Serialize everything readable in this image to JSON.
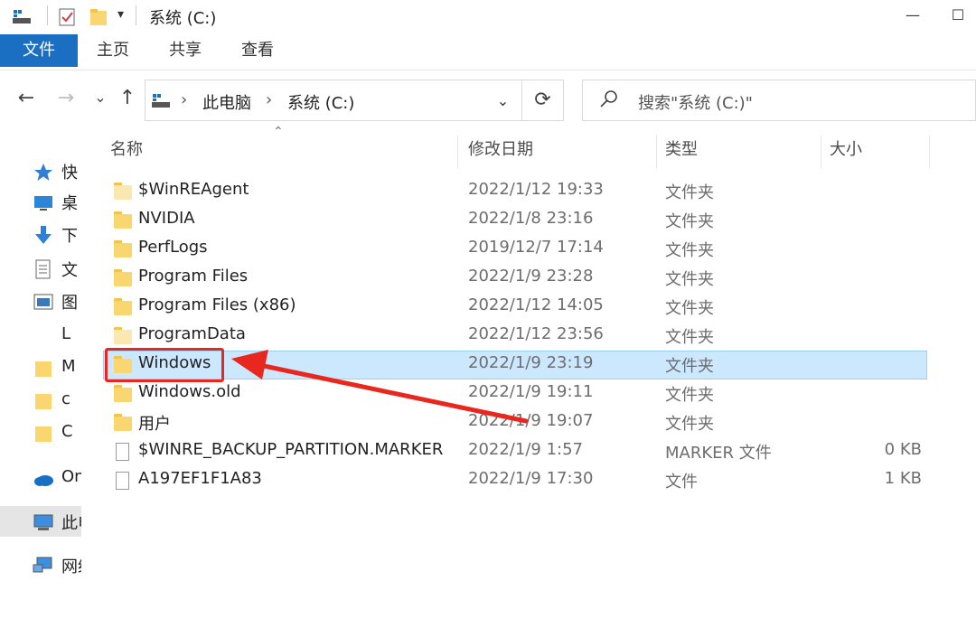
{
  "window": {
    "title": "系统 (C:)",
    "controls": {
      "minimize": "—",
      "maximize": "☐"
    }
  },
  "ribbon": {
    "tabs": [
      {
        "label": "文件"
      },
      {
        "label": "主页"
      },
      {
        "label": "共享"
      },
      {
        "label": "查看"
      }
    ]
  },
  "navigation": {
    "back": "←",
    "forward": "→",
    "recent": "⌄",
    "up": "↑",
    "breadcrumb": [
      {
        "label": "此电脑"
      },
      {
        "label": "系统 (C:)"
      }
    ],
    "refresh": "⟳",
    "search_placeholder": "搜索\"系统 (C:)\""
  },
  "nav_pane": {
    "items": [
      {
        "label": "快",
        "icon": "star-icon"
      },
      {
        "label": "桌",
        "icon": "desktop-icon"
      },
      {
        "label": "下",
        "icon": "download-icon"
      },
      {
        "label": "文",
        "icon": "documents-icon"
      },
      {
        "label": "图",
        "icon": "pictures-icon"
      },
      {
        "label": "L",
        "icon": "folder-icon"
      },
      {
        "label": "M",
        "icon": "folder-icon"
      },
      {
        "label": "c",
        "icon": "folder-icon"
      },
      {
        "label": "C",
        "icon": "folder-icon"
      },
      {
        "label": "On",
        "icon": "cloud-icon"
      },
      {
        "label": "此电",
        "icon": "this-pc-icon"
      },
      {
        "label": "网络",
        "icon": "network-icon"
      }
    ]
  },
  "columns": {
    "name": "名称",
    "date": "修改日期",
    "type": "类型",
    "size": "大小"
  },
  "files": [
    {
      "name": "$WinREAgent",
      "date": "2022/1/12 19:33",
      "type": "文件夹",
      "size": "",
      "kind": "folder-faded"
    },
    {
      "name": "NVIDIA",
      "date": "2022/1/8 23:16",
      "type": "文件夹",
      "size": "",
      "kind": "folder"
    },
    {
      "name": "PerfLogs",
      "date": "2019/12/7 17:14",
      "type": "文件夹",
      "size": "",
      "kind": "folder"
    },
    {
      "name": "Program Files",
      "date": "2022/1/9 23:28",
      "type": "文件夹",
      "size": "",
      "kind": "folder"
    },
    {
      "name": "Program Files (x86)",
      "date": "2022/1/12 14:05",
      "type": "文件夹",
      "size": "",
      "kind": "folder"
    },
    {
      "name": "ProgramData",
      "date": "2022/1/12 23:56",
      "type": "文件夹",
      "size": "",
      "kind": "folder-faded"
    },
    {
      "name": "Windows",
      "date": "2022/1/9 23:19",
      "type": "文件夹",
      "size": "",
      "kind": "folder",
      "selected": true
    },
    {
      "name": "Windows.old",
      "date": "2022/1/9 19:11",
      "type": "文件夹",
      "size": "",
      "kind": "folder"
    },
    {
      "name": "用户",
      "date": "2022/1/9 19:07",
      "type": "文件夹",
      "size": "",
      "kind": "folder"
    },
    {
      "name": "$WINRE_BACKUP_PARTITION.MARKER",
      "date": "2022/1/9 1:57",
      "type": "MARKER 文件",
      "size": "0 KB",
      "kind": "file"
    },
    {
      "name": "A197EF1F1A83",
      "date": "2022/1/9 17:30",
      "type": "文件",
      "size": "1 KB",
      "kind": "file"
    }
  ],
  "colors": {
    "accent": "#1a6fc2",
    "selection": "#cce8ff",
    "annotation": "#e8271e",
    "folder": "#f9d66f"
  }
}
